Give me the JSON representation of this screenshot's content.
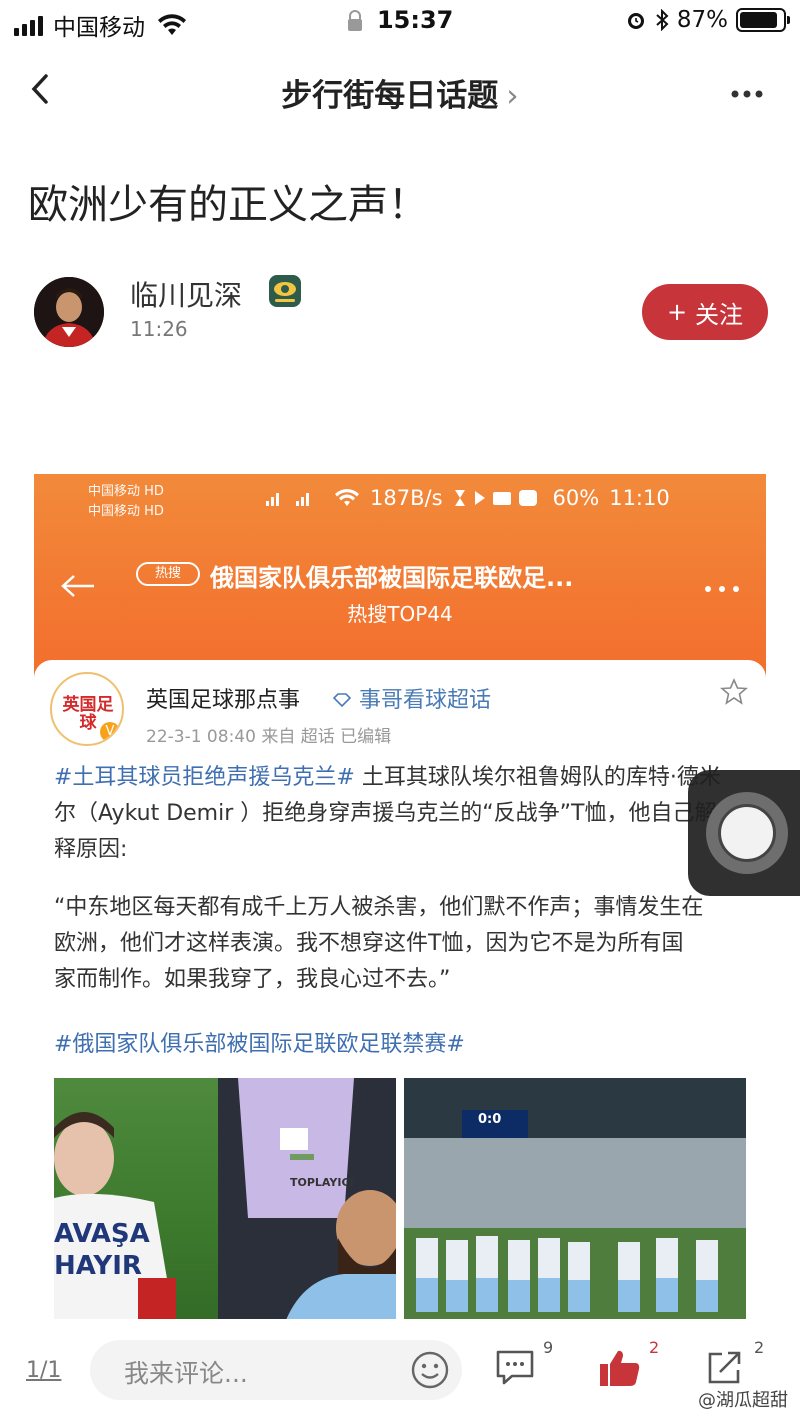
{
  "status_bar": {
    "carrier": "中国移动",
    "time": "15:37",
    "battery": "87%",
    "battery_level": 0.87
  },
  "nav": {
    "title": "步行街每日话题",
    "chevron": "›",
    "back_icon": "chevron-left-icon",
    "more_icon": "more-icon"
  },
  "post": {
    "title": "欧洲少有的正义之声！",
    "author": {
      "name": "临川见深",
      "time": "11:26",
      "follow_label": "关注",
      "follow_plus": "+",
      "accent": "#c7343a"
    }
  },
  "screenshot": {
    "status": {
      "carrier_line1": "中国移动 HD",
      "carrier_line2": "中国移动 HD",
      "speed": "187B/s",
      "battery": "60%",
      "time": "11:10"
    },
    "header": {
      "hot_tag": "热搜",
      "title": "俄国家队俱乐部被国际足联欧足...",
      "subtitle": "热搜TOP44"
    },
    "card": {
      "avatar_text": "英国足球",
      "name": "英国足球那点事",
      "super_topic": "事哥看球超话",
      "meta": "22-3-1 08:40  来自 超话  已编辑",
      "hashtag1": "#土耳其球员拒绝声援乌克兰#",
      "body": " 土耳其球队埃尔祖鲁姆队的库特·德米尔（Aykut Demir ）拒绝身穿声援乌克兰的“反战争”T恤，他自己解释原因:",
      "quote": "“中东地区每天都有成千上万人被杀害，他们默不作声；事情发生在欧洲，他们才这样表演。我不想穿这件T恤，因为它不是为所有国家而制作。如果我穿了，我良心过不去。”",
      "hashtag2": "#俄国家队俱乐部被国际足联欧足联禁赛#",
      "shirt_text": "AVAŞA\nHAYIR",
      "vest_text": "TOPLAYICI",
      "scoreboard": "0:0"
    }
  },
  "bottom_bar": {
    "page_indicator": "1/1",
    "comment_placeholder": "我来评论...",
    "comment_count": "9",
    "like_count": "2",
    "share_count": "2",
    "like_color": "#c7343a"
  },
  "watermark": "@湖瓜超甜"
}
